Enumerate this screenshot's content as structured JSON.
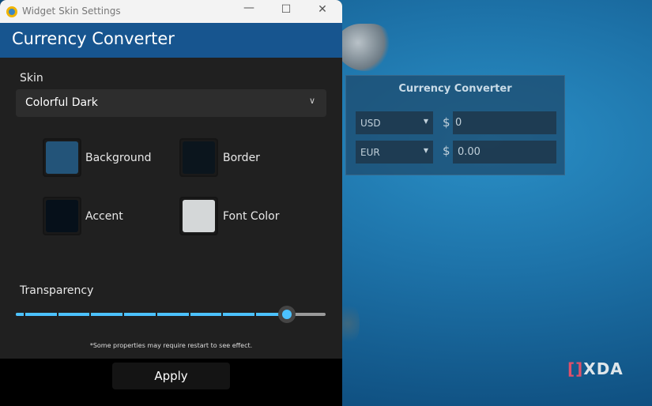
{
  "window": {
    "title": "Widget Skin Settings",
    "minimize_icon": "minimize-icon",
    "maximize_icon": "maximize-icon",
    "close_icon": "close-icon"
  },
  "header": {
    "title": "Currency Converter",
    "color": "#17558f"
  },
  "skin": {
    "label": "Skin",
    "selected": "Colorful Dark"
  },
  "colors": [
    {
      "label": "Background",
      "value": "#235479"
    },
    {
      "label": "Border",
      "value": "#0b151d"
    },
    {
      "label": "Accent",
      "value": "#06101a"
    },
    {
      "label": "Font Color",
      "value": "#d4d7d8"
    }
  ],
  "transparency": {
    "label": "Transparency",
    "value_percent": 87.5,
    "accent": "#4cc2ff"
  },
  "note": "*Some properties may require restart to see effect.",
  "apply_label": "Apply",
  "widget": {
    "title": "Currency Converter",
    "from_currency": "USD",
    "from_symbol": "$",
    "from_value": "0",
    "to_currency": "EUR",
    "to_symbol": "$",
    "to_value": "0.00"
  },
  "watermark": "XDA"
}
